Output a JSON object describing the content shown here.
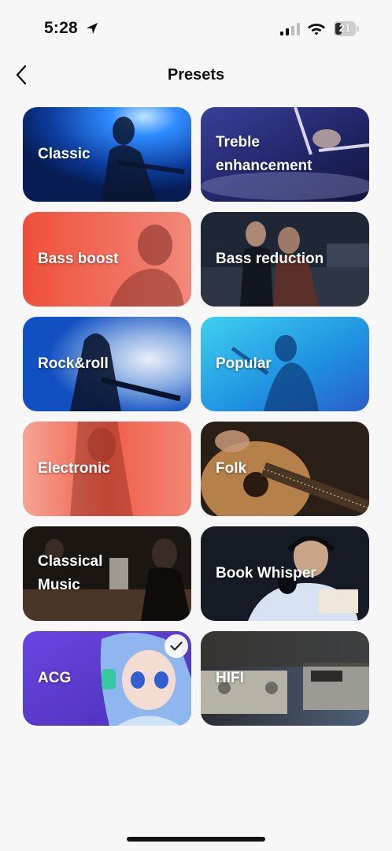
{
  "status_bar": {
    "time": "5:28",
    "battery_level": "21",
    "icons": [
      "location-arrow-icon",
      "cellular-signal-icon",
      "wifi-icon",
      "battery-icon"
    ]
  },
  "header": {
    "title": "Presets",
    "back_icon": "chevron-left-icon"
  },
  "presets": [
    {
      "label": "Classic",
      "selected": false,
      "theme": "#1b5fd6"
    },
    {
      "label": "Treble\nenhancement",
      "selected": false,
      "theme": "#2a2f78"
    },
    {
      "label": "Bass boost",
      "selected": false,
      "theme": "#e9543f"
    },
    {
      "label": "Bass reduction",
      "selected": false,
      "theme": "#2b3447"
    },
    {
      "label": "Rock&roll",
      "selected": false,
      "theme": "#1f62c9"
    },
    {
      "label": "Popular",
      "selected": false,
      "theme": "#23a6e6"
    },
    {
      "label": "Electronic",
      "selected": false,
      "theme": "#f06a52"
    },
    {
      "label": "Folk",
      "selected": false,
      "theme": "#3a2a1e"
    },
    {
      "label": "Classical\nMusic",
      "selected": false,
      "theme": "#2a211c"
    },
    {
      "label": "Book Whisper",
      "selected": false,
      "theme": "#1c2330"
    },
    {
      "label": "ACG",
      "selected": true,
      "theme": "#5b3bd1"
    },
    {
      "label": "HIFI",
      "selected": false,
      "theme": "#3a3d44"
    }
  ],
  "selected_icon": "checkmark-icon"
}
